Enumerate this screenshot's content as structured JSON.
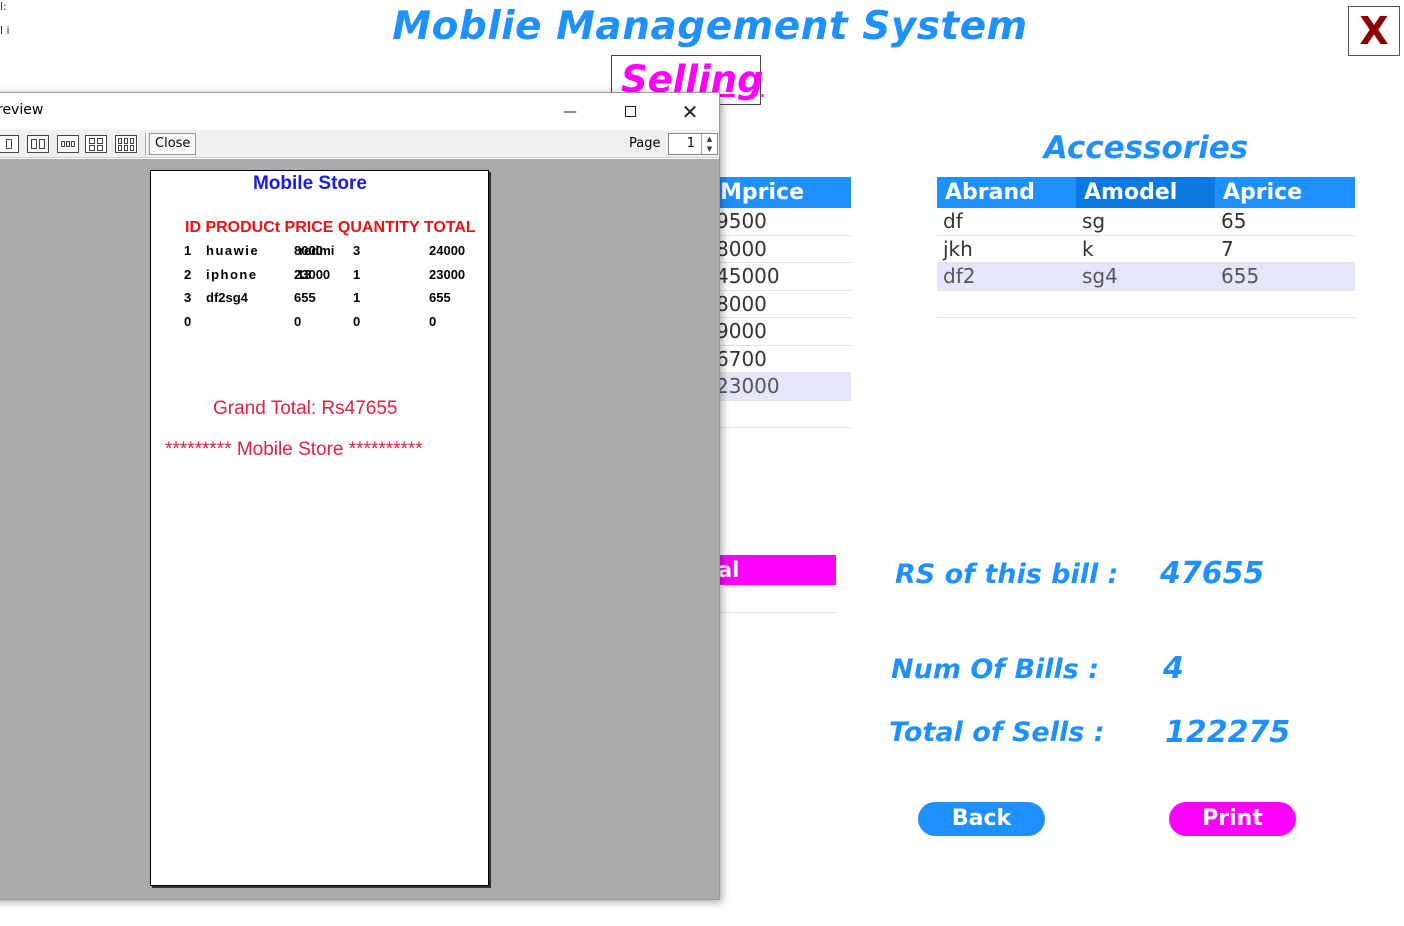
{
  "app": {
    "title": "Moblie Management System",
    "close_label": "X",
    "section_label": "Selling"
  },
  "mobile_table": {
    "header": "Mprice",
    "rows": [
      "9500",
      "8000",
      "45000",
      "8000",
      "9000",
      "6700",
      "23000"
    ],
    "selected_index": 6
  },
  "accessories": {
    "title": "Accessories",
    "headers": [
      "Abrand",
      "Amodel",
      "Aprice"
    ],
    "rows": [
      [
        "df",
        "sg",
        "65"
      ],
      [
        "jkh",
        "k",
        "7"
      ],
      [
        "df2",
        "sg4",
        "655"
      ]
    ],
    "selected_index": 2
  },
  "partial_button_label": "al",
  "stats": {
    "bill_label": "RS of this bill :",
    "bill_value": "47655",
    "num_bills_label": "Num Of Bills :",
    "num_bills_value": "4",
    "total_sells_label": "Total of Sells :",
    "total_sells_value": "122275"
  },
  "buttons": {
    "back": "Back",
    "print": "Print"
  },
  "left_fragments": [
    "l:",
    "l i"
  ],
  "preview": {
    "title": "review",
    "min_glyph": "—",
    "close_glyph": "✕",
    "toolbar_close": "Close",
    "page_label": "Page",
    "page_value": "1",
    "spin_up": "▲",
    "spin_down": "▼",
    "document": {
      "heading": "Mobile Store",
      "columns": "ID PRODUCt PRICE QUANTITY TOTAL",
      "rows": [
        {
          "id": "1",
          "name": "huawie",
          "price_overlap_a": "8000",
          "price_overlap_b": "redmi",
          "qty": "3",
          "total": "24000"
        },
        {
          "id": "2",
          "name": "iphone",
          "price_overlap_a": "23000",
          "price_overlap_b": "13",
          "qty": "1",
          "total": "23000"
        },
        {
          "id": "3",
          "name": "df2sg4",
          "price": "655",
          "qty": "1",
          "total": "655"
        },
        {
          "id": "0",
          "name": "",
          "price": "0",
          "qty": "0",
          "total": "0"
        }
      ],
      "grand_total": "Grand Total: Rs47655",
      "footer": "********* Mobile Store **********"
    }
  },
  "colors": {
    "primary_blue": "#1E90FF",
    "magenta": "#FF00FF",
    "close_red": "#8B0000",
    "preview_gray": "#ABABAB",
    "doc_red": "#EE1111",
    "doc_blue": "#1A1AE6"
  }
}
